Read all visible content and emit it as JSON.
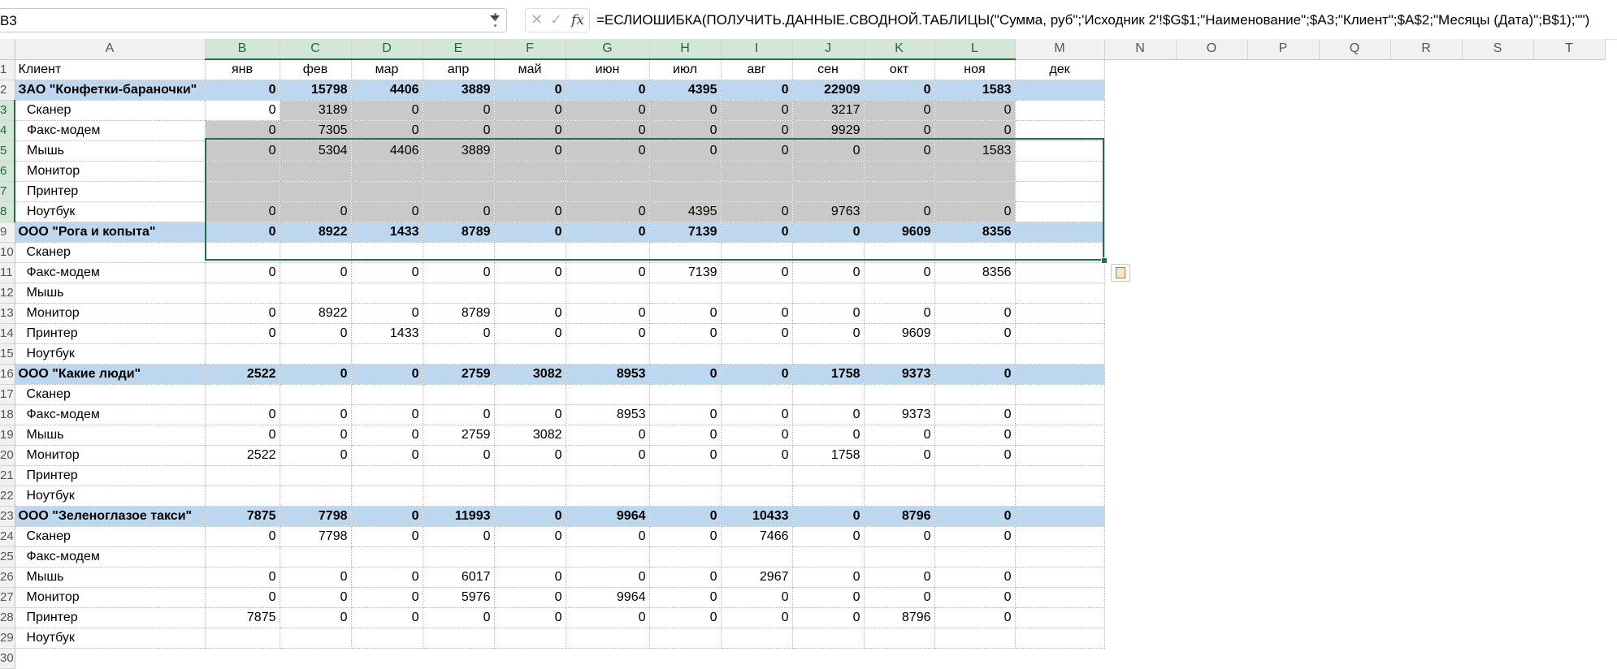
{
  "formula_bar": {
    "name_box": "B3",
    "formula": "=ЕСЛИОШИБКА(ПОЛУЧИТЬ.ДАННЫЕ.СВОДНОЙ.ТАБЛИЦЫ(\"Сумма, руб\";'Исходник 2'!$G$1;\"Наименование\";$A3;\"Клиент\";$A$2;\"Месяцы (Дата)\";B$1);\"\")",
    "cancel_glyph": "✕",
    "enter_glyph": "✓",
    "fx_glyph": "fx"
  },
  "columns": [
    "A",
    "B",
    "C",
    "D",
    "E",
    "F",
    "G",
    "H",
    "I",
    "J",
    "K",
    "L",
    "M",
    "N",
    "O",
    "P",
    "Q",
    "R",
    "S",
    "T"
  ],
  "header_row": {
    "client_label": "Клиент",
    "months": [
      "янв",
      "фев",
      "мар",
      "апр",
      "май",
      "июн",
      "июл",
      "авг",
      "сен",
      "окт",
      "ноя",
      "дек"
    ]
  },
  "rows": [
    {
      "num": "2",
      "kind": "client",
      "label": "ЗАО \"Конфетки-бараночки\"",
      "values": [
        "0",
        "15798",
        "4406",
        "3889",
        "0",
        "0",
        "4395",
        "0",
        "22909",
        "0",
        "1583",
        ""
      ]
    },
    {
      "num": "3",
      "kind": "item",
      "label": "Сканер",
      "values": [
        "0",
        "3189",
        "0",
        "0",
        "0",
        "0",
        "0",
        "0",
        "3217",
        "0",
        "0",
        ""
      ]
    },
    {
      "num": "4",
      "kind": "item",
      "label": "Факс-модем",
      "values": [
        "0",
        "7305",
        "0",
        "0",
        "0",
        "0",
        "0",
        "0",
        "9929",
        "0",
        "0",
        ""
      ]
    },
    {
      "num": "5",
      "kind": "item",
      "label": "Мышь",
      "values": [
        "0",
        "5304",
        "4406",
        "3889",
        "0",
        "0",
        "0",
        "0",
        "0",
        "0",
        "1583",
        ""
      ]
    },
    {
      "num": "6",
      "kind": "item",
      "label": "Монитор",
      "values": [
        "",
        "",
        "",
        "",
        "",
        "",
        "",
        "",
        "",
        "",
        "",
        ""
      ]
    },
    {
      "num": "7",
      "kind": "item",
      "label": "Принтер",
      "values": [
        "",
        "",
        "",
        "",
        "",
        "",
        "",
        "",
        "",
        "",
        "",
        ""
      ]
    },
    {
      "num": "8",
      "kind": "item",
      "label": "Ноутбук",
      "values": [
        "0",
        "0",
        "0",
        "0",
        "0",
        "0",
        "4395",
        "0",
        "9763",
        "0",
        "0",
        ""
      ]
    },
    {
      "num": "9",
      "kind": "client",
      "label": "ООО \"Рога и копыта\"",
      "values": [
        "0",
        "8922",
        "1433",
        "8789",
        "0",
        "0",
        "7139",
        "0",
        "0",
        "9609",
        "8356",
        ""
      ]
    },
    {
      "num": "10",
      "kind": "item",
      "label": "Сканер",
      "values": [
        "",
        "",
        "",
        "",
        "",
        "",
        "",
        "",
        "",
        "",
        "",
        ""
      ]
    },
    {
      "num": "11",
      "kind": "item",
      "label": "Факс-модем",
      "values": [
        "0",
        "0",
        "0",
        "0",
        "0",
        "0",
        "7139",
        "0",
        "0",
        "0",
        "8356",
        ""
      ]
    },
    {
      "num": "12",
      "kind": "item",
      "label": "Мышь",
      "values": [
        "",
        "",
        "",
        "",
        "",
        "",
        "",
        "",
        "",
        "",
        "",
        ""
      ]
    },
    {
      "num": "13",
      "kind": "item",
      "label": "Монитор",
      "values": [
        "0",
        "8922",
        "0",
        "8789",
        "0",
        "0",
        "0",
        "0",
        "0",
        "0",
        "0",
        ""
      ]
    },
    {
      "num": "14",
      "kind": "item",
      "label": "Принтер",
      "values": [
        "0",
        "0",
        "1433",
        "0",
        "0",
        "0",
        "0",
        "0",
        "0",
        "9609",
        "0",
        ""
      ]
    },
    {
      "num": "15",
      "kind": "item",
      "label": "Ноутбук",
      "values": [
        "",
        "",
        "",
        "",
        "",
        "",
        "",
        "",
        "",
        "",
        "",
        ""
      ]
    },
    {
      "num": "16",
      "kind": "client",
      "label": "ООО \"Какие люди\"",
      "values": [
        "2522",
        "0",
        "0",
        "2759",
        "3082",
        "8953",
        "0",
        "0",
        "1758",
        "9373",
        "0",
        ""
      ]
    },
    {
      "num": "17",
      "kind": "item",
      "label": "Сканер",
      "values": [
        "",
        "",
        "",
        "",
        "",
        "",
        "",
        "",
        "",
        "",
        "",
        ""
      ]
    },
    {
      "num": "18",
      "kind": "item",
      "label": "Факс-модем",
      "values": [
        "0",
        "0",
        "0",
        "0",
        "0",
        "8953",
        "0",
        "0",
        "0",
        "9373",
        "0",
        ""
      ]
    },
    {
      "num": "19",
      "kind": "item",
      "label": "Мышь",
      "values": [
        "0",
        "0",
        "0",
        "2759",
        "3082",
        "0",
        "0",
        "0",
        "0",
        "0",
        "0",
        ""
      ]
    },
    {
      "num": "20",
      "kind": "item",
      "label": "Монитор",
      "values": [
        "2522",
        "0",
        "0",
        "0",
        "0",
        "0",
        "0",
        "0",
        "1758",
        "0",
        "0",
        ""
      ]
    },
    {
      "num": "21",
      "kind": "item",
      "label": "Принтер",
      "values": [
        "",
        "",
        "",
        "",
        "",
        "",
        "",
        "",
        "",
        "",
        "",
        ""
      ]
    },
    {
      "num": "22",
      "kind": "item",
      "label": "Ноутбук",
      "values": [
        "",
        "",
        "",
        "",
        "",
        "",
        "",
        "",
        "",
        "",
        "",
        ""
      ]
    },
    {
      "num": "23",
      "kind": "client",
      "label": "ООО \"Зеленоглазое такси\"",
      "values": [
        "7875",
        "7798",
        "0",
        "11993",
        "0",
        "9964",
        "0",
        "10433",
        "0",
        "8796",
        "0",
        ""
      ]
    },
    {
      "num": "24",
      "kind": "item",
      "label": "Сканер",
      "values": [
        "0",
        "7798",
        "0",
        "0",
        "0",
        "0",
        "0",
        "7466",
        "0",
        "0",
        "0",
        ""
      ]
    },
    {
      "num": "25",
      "kind": "item",
      "label": "Факс-модем",
      "values": [
        "",
        "",
        "",
        "",
        "",
        "",
        "",
        "",
        "",
        "",
        "",
        ""
      ]
    },
    {
      "num": "26",
      "kind": "item",
      "label": "Мышь",
      "values": [
        "0",
        "0",
        "0",
        "6017",
        "0",
        "0",
        "0",
        "2967",
        "0",
        "0",
        "0",
        ""
      ]
    },
    {
      "num": "27",
      "kind": "item",
      "label": "Монитор",
      "values": [
        "0",
        "0",
        "0",
        "5976",
        "0",
        "9964",
        "0",
        "0",
        "0",
        "0",
        "0",
        ""
      ]
    },
    {
      "num": "28",
      "kind": "item",
      "label": "Принтер",
      "values": [
        "7875",
        "0",
        "0",
        "0",
        "0",
        "0",
        "0",
        "0",
        "0",
        "8796",
        "0",
        ""
      ]
    },
    {
      "num": "29",
      "kind": "item",
      "label": "Ноутбук",
      "values": [
        "",
        "",
        "",
        "",
        "",
        "",
        "",
        "",
        "",
        "",
        "",
        ""
      ]
    },
    {
      "num": "30",
      "kind": "empty",
      "label": "",
      "values": []
    }
  ],
  "selection": {
    "range": "B3:L8",
    "active_cell": "B3"
  },
  "colors": {
    "client_fill": "#bdd7ee",
    "selected_fill": "#c9c9c9",
    "selection_border": "#217346"
  }
}
